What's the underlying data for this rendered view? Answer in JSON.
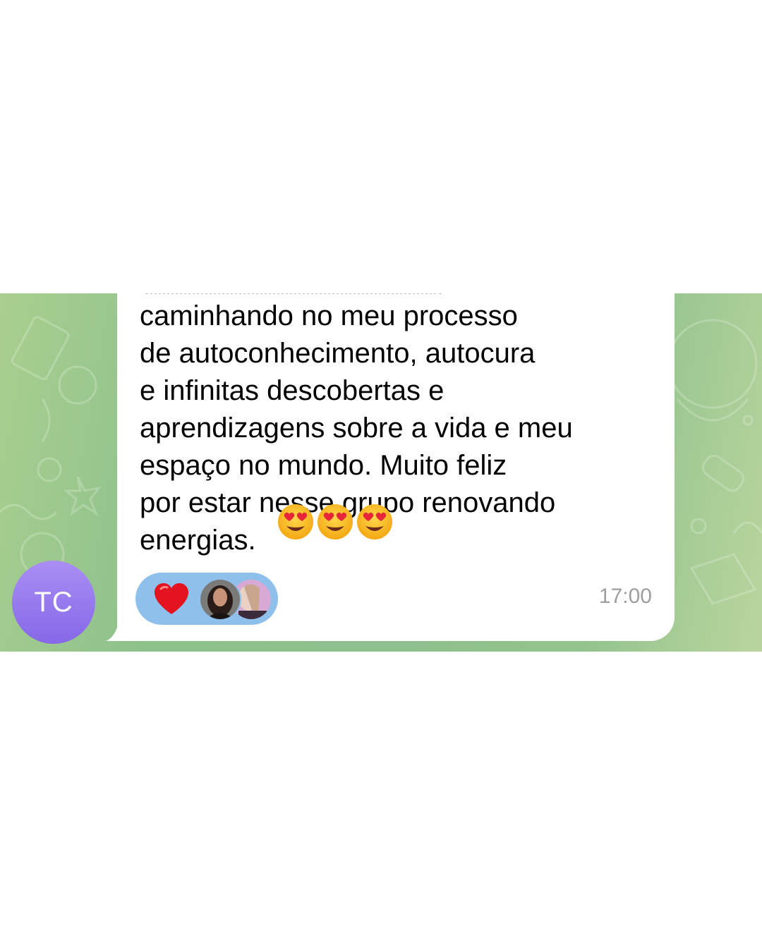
{
  "avatar": {
    "initials": "TC",
    "color_top": "#a98ef3",
    "color_bottom": "#8668e8"
  },
  "message": {
    "text": "caminhando no meu processo\nde autoconhecimento, autocura\ne infinitas descobertas e\naprendizagens sobre a vida e meu\nespaço no mundo. Muito feliz\npor estar nesse grupo renovando\nenergias.",
    "emojis": [
      "heart-eyes-emoji",
      "heart-eyes-emoji",
      "heart-eyes-emoji"
    ],
    "time": "17:00"
  },
  "reaction": {
    "icon": "red-heart-icon",
    "reactors": [
      "reactor-avatar-1",
      "reactor-avatar-2"
    ],
    "pill_color": "#8fc0ec"
  },
  "colors": {
    "wallpaper": "#8ec08d",
    "bubble": "#ffffff",
    "timestamp": "#9e9e9e"
  }
}
